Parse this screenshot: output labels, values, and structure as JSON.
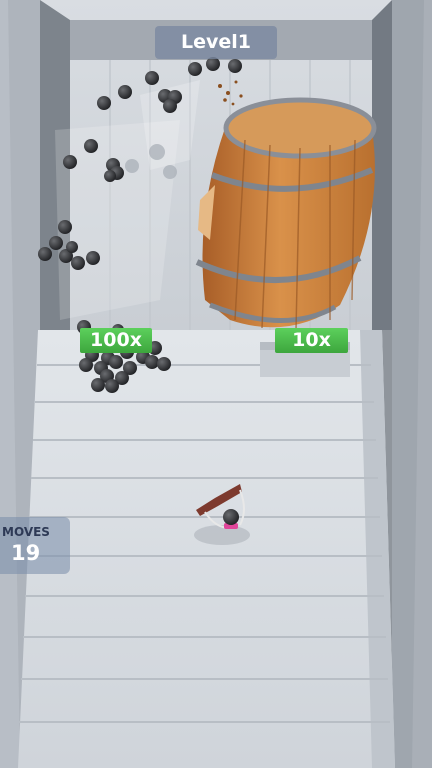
{
  "hud": {
    "level_label": "Level1",
    "moves_label": "MOVES",
    "moves_value": "19"
  },
  "multipliers": [
    "100x",
    "10x"
  ],
  "scene": {
    "barrel_icon": "wooden-barrel",
    "slingshot_icon": "slingshot-with-ball",
    "ball_icon": "black-ball"
  },
  "colors": {
    "multiplier_green": "#4cbb4c",
    "barrel_wood": "#c27a3c",
    "floor": "#d8dde3",
    "ball": "#2f3034"
  }
}
